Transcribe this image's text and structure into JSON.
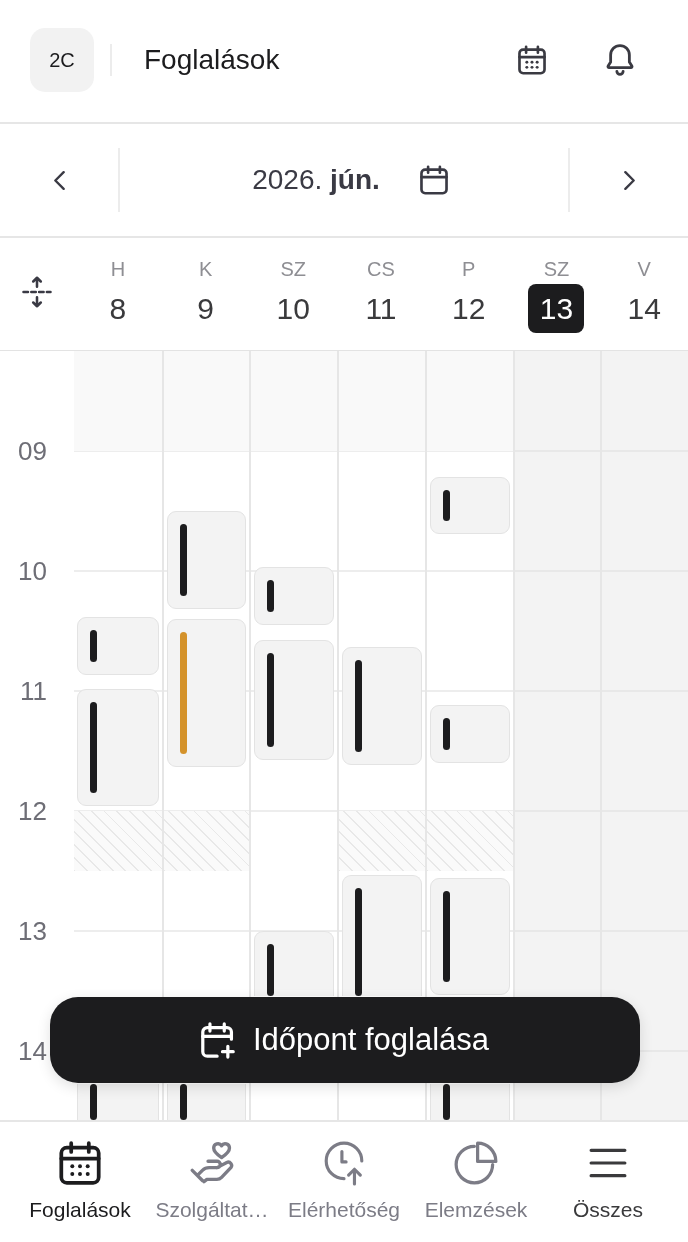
{
  "header": {
    "logo": "2C",
    "title": "Foglalások"
  },
  "month_nav": {
    "label": "2026. **jún.**"
  },
  "calendar": {
    "days": [
      {
        "weekday": "H",
        "date": "8",
        "selected": false,
        "closed": false,
        "break": true,
        "events": [
          {
            "color": "#1c1c1e"
          },
          {
            "color": "#1c1c1e"
          },
          {
            "color": "#1c1c1e"
          }
        ]
      },
      {
        "weekday": "K",
        "date": "9",
        "selected": false,
        "closed": false,
        "break": true,
        "events": [
          {
            "color": "#1c1c1e"
          },
          {
            "color": "#d4922a"
          },
          {
            "color": "#1c1c1e"
          }
        ]
      },
      {
        "weekday": "SZ",
        "date": "10",
        "selected": false,
        "closed": false,
        "break": false,
        "events": [
          {
            "color": "#1c1c1e"
          },
          {
            "color": "#1c1c1e"
          },
          {
            "color": "#1c1c1e"
          }
        ]
      },
      {
        "weekday": "CS",
        "date": "11",
        "selected": false,
        "closed": false,
        "break": true,
        "events": [
          {
            "color": "#1c1c1e"
          },
          {
            "color": "#1c1c1e"
          }
        ]
      },
      {
        "weekday": "P",
        "date": "12",
        "selected": false,
        "closed": false,
        "break": true,
        "events": [
          {
            "color": "#1c1c1e"
          },
          {
            "color": "#1c1c1e"
          },
          {
            "color": "#1c1c1e"
          },
          {
            "color": "#1c1c1e"
          }
        ]
      },
      {
        "weekday": "SZ",
        "date": "13",
        "selected": true,
        "closed": true,
        "break": false
      },
      {
        "weekday": "V",
        "date": "14",
        "selected": false,
        "closed": true,
        "break": false
      }
    ],
    "hours": [
      "09",
      "10",
      "11",
      "12",
      "13",
      "14"
    ]
  },
  "book_button": {
    "label": "Időpont foglalása"
  },
  "bottom_nav": [
    {
      "label": "Foglalások",
      "kind": "tab",
      "selected": true
    },
    {
      "label": "Szolgáltat…",
      "kind": "tab",
      "selected": false
    },
    {
      "label": "Elérhetőség",
      "kind": "tab",
      "selected": false
    },
    {
      "label": "Elemzések",
      "kind": "tab",
      "selected": false
    },
    {
      "label": "Összes",
      "kind": "more",
      "selected": false
    }
  ]
}
